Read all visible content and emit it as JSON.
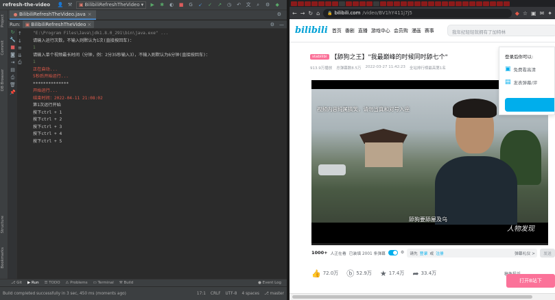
{
  "ide": {
    "project_name": "refresh-the-video",
    "run_config": "BilibiliRefreshTheVideo",
    "file_tab": "BilibiliRefreshTheVideo.java",
    "run_label": "Run:",
    "run_tab": "BilibiliRefreshTheVideo",
    "side_labels": [
      "Project",
      "Commit",
      "DB Browser",
      "Structure",
      "Bookmarks"
    ],
    "console_lines": [
      {
        "text": "\"E:\\Program Files\\Java\\jdk1.8.0_291\\bin\\java.exe\" ...",
        "color": "gray"
      },
      {
        "text": "请输入运行次数，不输入则默认为1次(直接按回车)：",
        "color": "white"
      },
      {
        "text": "1",
        "color": "green"
      },
      {
        "text": "请输入单个视频最长时间（分钟，例：2分35秒输入3），不输入则默认为6分钟(直接按回车)：",
        "color": "white"
      },
      {
        "text": "1",
        "color": "green"
      },
      {
        "text": "正在启动...",
        "color": "red"
      },
      {
        "text": "5秒后开始运行...",
        "color": "red"
      },
      {
        "text": "**************",
        "color": "white"
      },
      {
        "text": "开始运行...",
        "color": "red"
      },
      {
        "text": "结束时间：2022-04-11 21:08:02",
        "color": "red"
      },
      {
        "text": "第1次运行开始",
        "color": "white"
      },
      {
        "text": "按下ctrl + 1",
        "color": "white"
      },
      {
        "text": "按下ctrl + 2",
        "color": "white"
      },
      {
        "text": "按下ctrl + 3",
        "color": "white"
      },
      {
        "text": "按下ctrl + 4",
        "color": "white"
      },
      {
        "text": "按下ctrl + 5",
        "color": "white"
      }
    ],
    "bottom_tools": [
      "Git",
      "Run",
      "TODO",
      "Problems",
      "Terminal",
      "Build"
    ],
    "event_log": "Event Log",
    "status_left": "Build completed successfully in 3 sec, 450 ms (moments ago)",
    "status_right": [
      "17:1",
      "CRLF",
      "UTF-8",
      "4 spaces",
      "master"
    ]
  },
  "browser": {
    "url_host": "bilibili.com",
    "url_path": "/video/BV1hY411j7j5",
    "logo": "bilibili",
    "nav": [
      "首页",
      "番剧",
      "直播",
      "游戏中心",
      "会员购",
      "漫画",
      "赛事"
    ],
    "search_placeholder": "我年纪轻轻就拥有了加特林",
    "video": {
      "badge": "stabilibi",
      "title": "【舔狗之王】\"我最巅峰的时候同时舔七个\"",
      "meta": [
        "913.9万播放",
        "总弹幕数8.5万",
        "2022-03-27 11:42:23",
        "全站排行榜最高第1名"
      ],
      "overlay_text": "视频内容纯属搞笑，请勿当真和对号入座",
      "subtitle": "舔狗要舔屋及乌",
      "watermark": "人物发现"
    },
    "danmaku": {
      "viewers": "1000+",
      "viewers_suffix": "人正在看",
      "loaded": "已装填 2001 条弹幕",
      "input_hint": "请先",
      "login_link": "登录",
      "or": "或",
      "register_link": "注册",
      "etiquette": "弹幕礼仪 >",
      "send": "发送"
    },
    "actions": [
      {
        "icon": "like-icon",
        "label": "72.0万"
      },
      {
        "icon": "coin-icon",
        "label": "52.9万"
      },
      {
        "icon": "star-icon",
        "label": "17.4万"
      },
      {
        "icon": "share-icon",
        "label": "33.4万"
      }
    ],
    "draft_label": "稿件投诉",
    "login_panel": {
      "heading": "登录后你可以:",
      "perks": [
        "免费看高清",
        "发表弹幕/评"
      ]
    },
    "open_app": "打开B站下"
  }
}
